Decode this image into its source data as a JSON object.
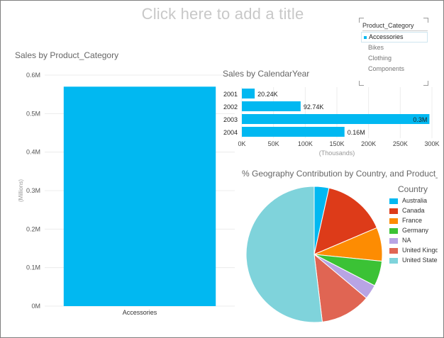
{
  "report": {
    "title_placeholder": "Click here to add a title"
  },
  "slicer": {
    "header": "Product_Category",
    "items": [
      {
        "label": "Accessories",
        "selected": true
      },
      {
        "label": "Bikes",
        "selected": false
      },
      {
        "label": "Clothing",
        "selected": false
      },
      {
        "label": "Components",
        "selected": false
      }
    ]
  },
  "column_chart": {
    "title": "Sales by Product_Category"
  },
  "bar_chart": {
    "title": "Sales by CalendarYear"
  },
  "pie_chart": {
    "title": "% Geography Contribution by Country, and Product_Category"
  },
  "legend": {
    "title": "Country",
    "items": [
      {
        "label": "Australia",
        "color": "#01b8f1"
      },
      {
        "label": "Canada",
        "color": "#dd3b19"
      },
      {
        "label": "France",
        "color": "#fd8c02"
      },
      {
        "label": "Germany",
        "color": "#3bc235"
      },
      {
        "label": "NA",
        "color": "#b8a4e4"
      },
      {
        "label": "United Kingdom",
        "color": "#e06553"
      },
      {
        "label": "United States",
        "color": "#7fd3db"
      }
    ]
  },
  "chart_data": [
    {
      "type": "bar",
      "categories": [
        "Accessories"
      ],
      "values": [
        0.57
      ],
      "title": "Sales by Product_Category",
      "xlabel": "",
      "ylabel": "(Millions)",
      "ylim": [
        0,
        0.6
      ],
      "yticks": [
        "0M",
        "0.1M",
        "0.2M",
        "0.3M",
        "0.4M",
        "0.5M",
        "0.6M"
      ],
      "color": "#01b8f1",
      "grid": true
    },
    {
      "type": "bar",
      "orientation": "horizontal",
      "categories": [
        "2001",
        "2002",
        "2003",
        "2004"
      ],
      "values": [
        20.24,
        92.74,
        296,
        162
      ],
      "data_labels": [
        "20.24K",
        "92.74K",
        "0.3M",
        "0.16M"
      ],
      "title": "Sales by CalendarYear",
      "xlabel": "(Thousands)",
      "ylabel": "",
      "xlim": [
        0,
        300
      ],
      "xticks": [
        "0K",
        "50K",
        "100K",
        "150K",
        "200K",
        "250K",
        "300K"
      ],
      "color": "#01b8f1",
      "grid": true
    },
    {
      "type": "pie",
      "title": "% Geography Contribution by Country, and Product_Category",
      "categories": [
        "Australia",
        "Canada",
        "France",
        "Germany",
        "NA",
        "United Kingdom",
        "United States"
      ],
      "values": [
        3.5,
        15.1,
        8.0,
        6.0,
        3.5,
        12.0,
        51.9
      ],
      "colors": [
        "#01b8f1",
        "#dd3b19",
        "#fd8c02",
        "#3bc235",
        "#b8a4e4",
        "#e06553",
        "#7fd3db"
      ],
      "legend_title": "Country",
      "legend_position": "right"
    }
  ]
}
